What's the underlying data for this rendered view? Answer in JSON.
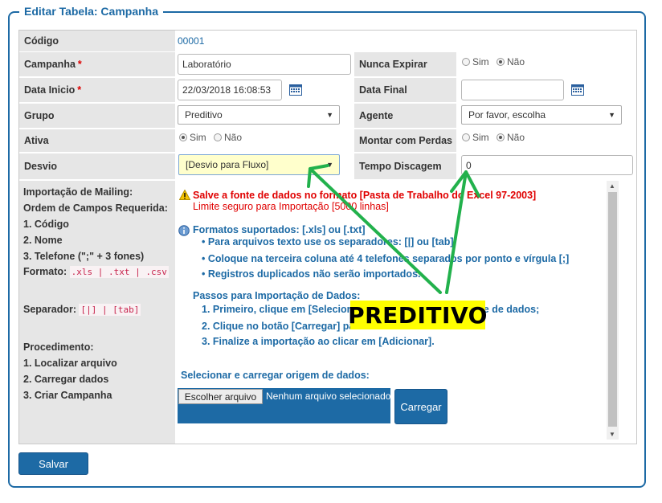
{
  "form": {
    "legend": "Editar Tabela: Campanha",
    "codigo_label": "Código",
    "codigo_value": "00001",
    "campanha_label": "Campanha",
    "campanha_value": "Laboratório",
    "nunca_expirar_label": "Nunca Expirar",
    "data_inicio_label": "Data Inicio",
    "data_inicio_value": "22/03/2018 16:08:53",
    "data_final_label": "Data Final",
    "data_final_value": "",
    "grupo_label": "Grupo",
    "grupo_value": "Preditivo",
    "agente_label": "Agente",
    "agente_value": "Por favor, escolha",
    "ativa_label": "Ativa",
    "montar_label": "Montar com Perdas",
    "desvio_label": "Desvio",
    "desvio_value": "[Desvio para Fluxo]",
    "tempo_label": "Tempo Discagem",
    "tempo_value": "0",
    "required_mark": "*",
    "radio_sim": "Sim",
    "radio_nao": "Não",
    "nunca_expirar_selected": "Não",
    "ativa_selected": "Sim",
    "montar_selected": "Não"
  },
  "left_info": {
    "line1": "Importação de Mailing:",
    "line2": "Ordem de Campos Requerida:",
    "line3": "1. Código",
    "line4": "2. Nome",
    "line5": "3. Telefone (\";\" + 3 fones)",
    "formato_label": "Formato:",
    "formato_code": ".xls | .txt | .csv",
    "separador_label": "Separador:",
    "separador_code": "[|] | [tab]",
    "proc_title": "Procedimento:",
    "proc1": "1. Localizar arquivo",
    "proc2": "2. Carregar dados",
    "proc3": "3. Criar Campanha"
  },
  "right_info": {
    "warn1": "Salve a fonte de dados no formato [Pasta de Trabalho do Excel 97-2003]",
    "warn2": "Limite seguro para Importação [5000 linhas]",
    "formats": "Formatos suportados: [.xls] ou [.txt]",
    "b1": "Para arquivos texto use os separadores: [|] ou [tab]",
    "b2": "Coloque na terceira coluna até 4 telefones separados por ponto e vírgula [;]",
    "b3": "Registros duplicados não serão importados.",
    "steps_title": "Passos para Importação de Dados:",
    "s1": "1. Primeiro, clique em [Selecionar arquivo] e escolha a fonte de dados;",
    "s2": "2. Clique no botão [Carregar] para",
    "s3": "3. Finalize a importação ao clicar em [Adicionar].",
    "select_title": "Selecionar e carregar origem de dados:",
    "file_button": "Escolher arquivo",
    "file_status": "Nenhum arquivo selecionado",
    "carregar": "Carregar"
  },
  "footer": {
    "salvar": "Salvar"
  },
  "overlay": {
    "text": "PREDITIVO"
  },
  "colors": {
    "accent": "#1d6aa5",
    "overlay_bg": "#ffff00",
    "arrow": "#22b14c",
    "required": "#dd0000"
  }
}
